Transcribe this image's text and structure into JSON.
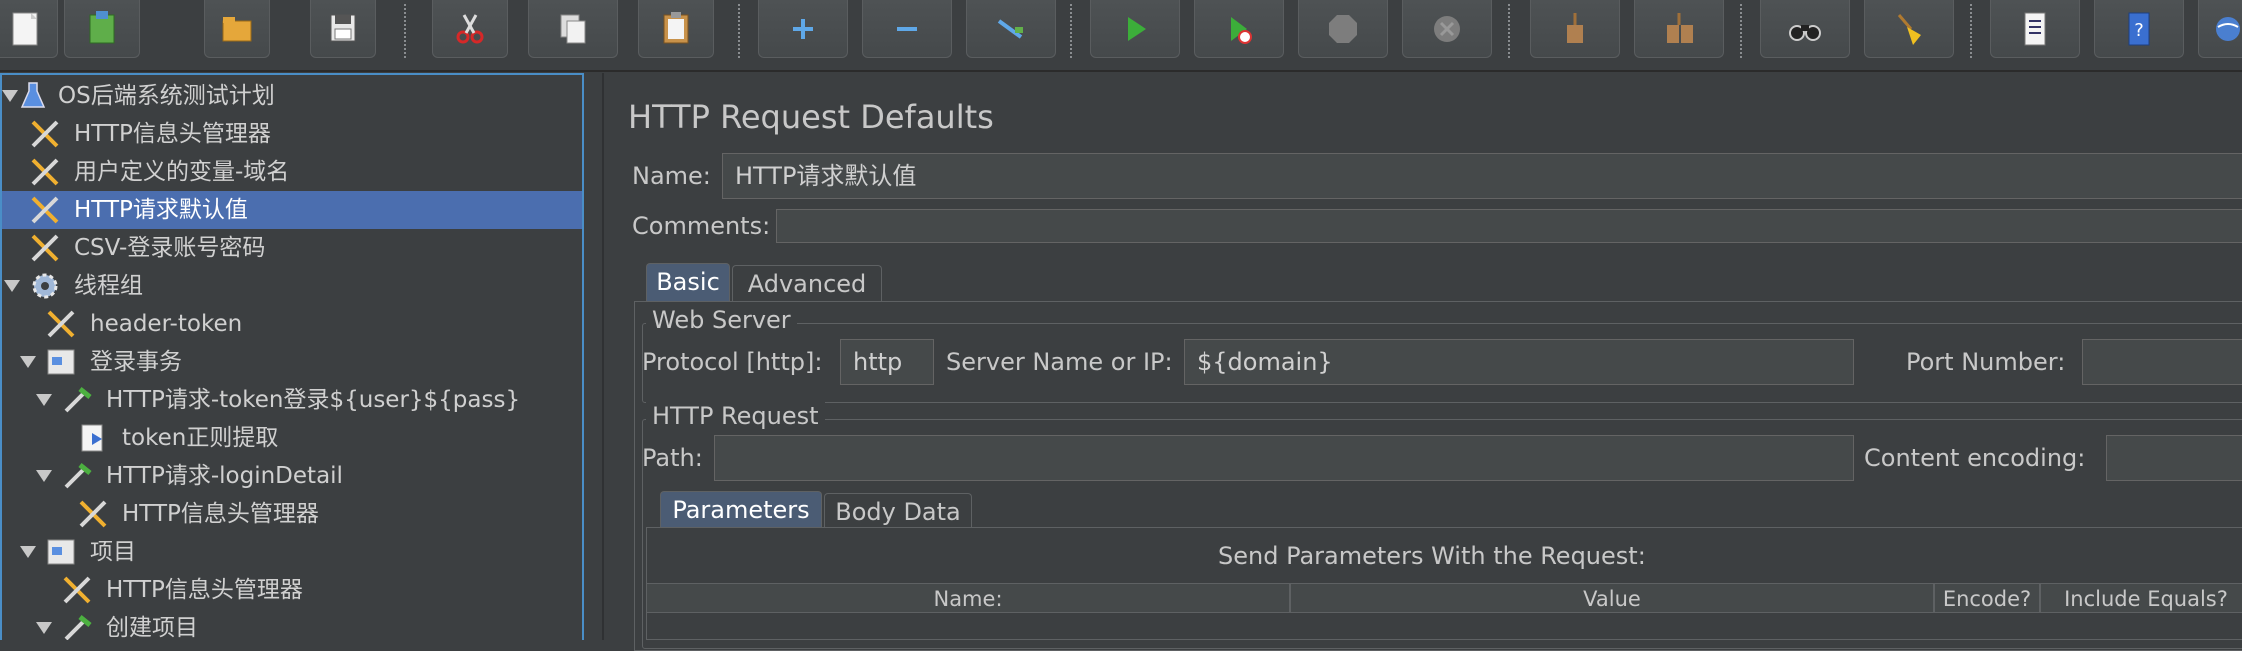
{
  "toolbar": {
    "buttons": [
      {
        "name": "new-button",
        "icon": "new-file-icon"
      },
      {
        "name": "templates-button",
        "icon": "templates-icon"
      },
      {
        "name": "open-button",
        "icon": "open-folder-icon"
      },
      {
        "name": "save-button",
        "icon": "save-icon"
      },
      {
        "name": "cut-button",
        "icon": "scissors-icon"
      },
      {
        "name": "copy-button",
        "icon": "copy-icon"
      },
      {
        "name": "paste-button",
        "icon": "paste-icon"
      },
      {
        "name": "expand-all-button",
        "icon": "plus-icon"
      },
      {
        "name": "collapse-all-button",
        "icon": "minus-icon"
      },
      {
        "name": "toggle-button",
        "icon": "toggle-icon"
      },
      {
        "name": "start-button",
        "icon": "play-icon"
      },
      {
        "name": "start-no-pauses-button",
        "icon": "play-no-timer-icon"
      },
      {
        "name": "stop-button",
        "icon": "stop-icon"
      },
      {
        "name": "shutdown-button",
        "icon": "shutdown-icon"
      },
      {
        "name": "clear-button",
        "icon": "broom-clear-icon"
      },
      {
        "name": "clear-all-button",
        "icon": "broom-clear-all-icon"
      },
      {
        "name": "search-button",
        "icon": "binoculars-icon"
      },
      {
        "name": "reset-search-button",
        "icon": "broom-icon"
      },
      {
        "name": "function-helper-button",
        "icon": "list-icon"
      },
      {
        "name": "help-button",
        "icon": "help-book-icon"
      },
      {
        "name": "remote-button",
        "icon": "globe-icon"
      }
    ]
  },
  "tree": {
    "items": [
      {
        "label": "OS后端系统测试计划",
        "icon": "flask-icon",
        "expanded": true
      },
      {
        "label": "HTTP信息头管理器",
        "icon": "wrench-screwdriver-icon"
      },
      {
        "label": "用户定义的变量-域名",
        "icon": "wrench-screwdriver-icon"
      },
      {
        "label": "HTTP请求默认值",
        "icon": "wrench-screwdriver-icon",
        "selected": true
      },
      {
        "label": "CSV-登录账号密码",
        "icon": "wrench-screwdriver-icon"
      },
      {
        "label": "线程组",
        "icon": "gear-icon",
        "expanded": true
      },
      {
        "label": "header-token",
        "icon": "wrench-screwdriver-icon"
      },
      {
        "label": "登录事务",
        "icon": "transaction-icon",
        "expanded": true
      },
      {
        "label": "HTTP请求-token登录${user}${pass}",
        "icon": "pipette-icon",
        "expanded": true
      },
      {
        "label": "token正则提取",
        "icon": "extractor-icon"
      },
      {
        "label": "HTTP请求-loginDetail",
        "icon": "pipette-icon",
        "expanded": true
      },
      {
        "label": "HTTP信息头管理器",
        "icon": "wrench-screwdriver-icon"
      },
      {
        "label": "项目",
        "icon": "transaction-icon",
        "expanded": true
      },
      {
        "label": "HTTP信息头管理器",
        "icon": "wrench-screwdriver-icon"
      },
      {
        "label": "创建项目",
        "icon": "pipette-icon",
        "expanded": true
      }
    ]
  },
  "panel": {
    "title": "HTTP Request Defaults",
    "name_label": "Name:",
    "name_value": "HTTP请求默认值",
    "comments_label": "Comments:",
    "comments_value": "",
    "tabs": [
      {
        "label": "Basic",
        "active": true
      },
      {
        "label": "Advanced",
        "active": false
      }
    ],
    "web_server": {
      "title": "Web Server",
      "protocol_label": "Protocol [http]:",
      "protocol_value": "http",
      "server_label": "Server Name or IP:",
      "server_value": "${domain}",
      "port_label": "Port Number:",
      "port_value": ""
    },
    "http_request": {
      "title": "HTTP Request",
      "path_label": "Path:",
      "path_value": "",
      "encoding_label": "Content encoding:",
      "encoding_value": ""
    },
    "sub_tabs": [
      {
        "label": "Parameters",
        "active": true
      },
      {
        "label": "Body Data",
        "active": false
      }
    ],
    "parameters": {
      "title": "Send Parameters With the Request:",
      "columns": [
        "Name:",
        "Value",
        "Encode?",
        "Include Equals?"
      ]
    }
  },
  "colors": {
    "background": "#3c3f41",
    "selection": "#4b6eaf",
    "tree_border": "#4a8ec7",
    "field_bg": "#45494a"
  }
}
